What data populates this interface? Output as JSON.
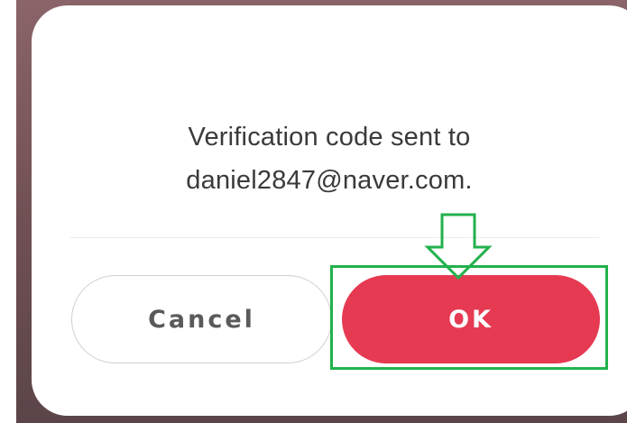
{
  "dialog": {
    "message_line1": "Verification code sent to",
    "message_line2": "daniel2847@naver.com.",
    "cancel_label": "Cancel",
    "ok_label": "OK"
  },
  "annotation": {
    "icon": "down-arrow-icon",
    "color": "#22b14c"
  },
  "colors": {
    "ok_button": "#e63a52",
    "cancel_border": "#cfcfcf",
    "backdrop": "#7a5a5e"
  }
}
